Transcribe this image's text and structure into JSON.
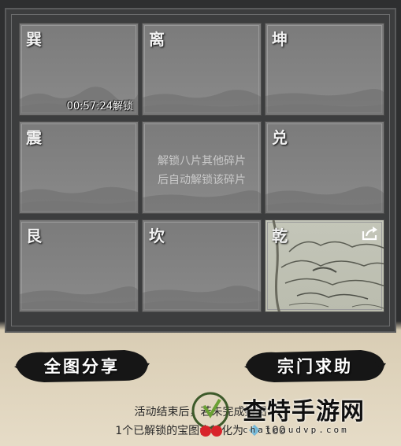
{
  "tiles": [
    {
      "glyph": "巽",
      "timer": "00:57:24解锁"
    },
    {
      "glyph": "离"
    },
    {
      "glyph": "坤"
    },
    {
      "glyph": "震"
    },
    {
      "hint_line1": "解锁八片其他碎片",
      "hint_line2": "后自动解锁该碎片"
    },
    {
      "glyph": "兑"
    },
    {
      "glyph": "艮"
    },
    {
      "glyph": "坎"
    },
    {
      "glyph": "乾",
      "share_icon": "share-icon"
    }
  ],
  "buttons": {
    "share_full": "全图分享",
    "sect_help": "宗门求助"
  },
  "info": {
    "line1": "活动结束后，若未完成拼图",
    "line2": "1个已解锁的宝图会转化为",
    "amount": "100"
  },
  "watermark": {
    "title": "查特手游网",
    "url": "chateaudvp.com"
  }
}
